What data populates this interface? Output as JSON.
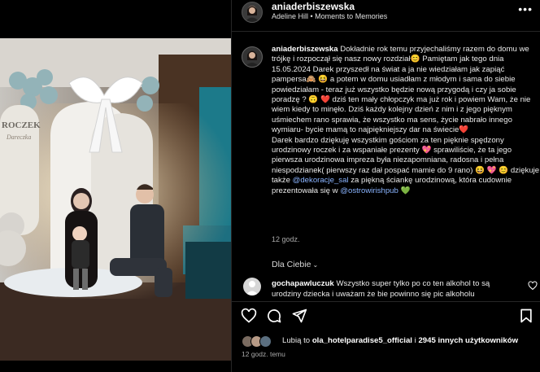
{
  "post": {
    "username": "aniaderbiszewska",
    "subtitle": "Adeline Hill • Moments to Memories",
    "caption_user": "aniaderbiszewska",
    "caption_text_1": "Dokładnie rok temu przyjechaliśmy razem do domu we trójkę i rozpoczął się nasz nowy rozdział😊 Pamiętam jak tego dnia 15.05.2024 Darek przyszedł na świat a ja nie wiedziałam jak zapiąć pampersa🙈 😆 a potem w domu usiadłam z młodym i sama do siebie powiedziałam - teraz już wszystko będzie nową przygodą i czy ja sobie poradzę ? 🙃 ❤️ dziś ten mały chłopczyk ma już rok i powiem Wam, że nie wiem kiedy to minęło. Dziś każdy kolejny dzień z nim i z jego pięknym uśmiechem rano sprawia, że wszystko ma sens, życie nabrało innego wymiaru- bycie mamą to najpiękniejszy dar na świecie❤️",
    "caption_text_2": "Darek bardzo dziękuję wszystkim gościom za ten pięknie spędzony urodzinowy roczek i za wspaniałe prezenty 💖 sprawiliście, że ta jego pierwsza urodzinowa impreza była niezapomniana, radosna i pełna niespodzianek( pierwszy raz dał pospać mamie do 9 rano) 😆 💖 😊 dziękuje także",
    "mention_1": "@dekoracje_sal",
    "caption_text_3": "za piękną ściankę urodzinową, która cudownie prezentowała się w",
    "mention_2": "@ostrowirishpub",
    "caption_text_4": "💚",
    "time": "12 godz.",
    "for_you": "Dla Ciebie",
    "comment_user": "gochapawluczuk",
    "comment_text": "Wszystko super tylko po co ten alkohol to są urodziny dziecka i uważam że bie powinno się pic alkoholu",
    "likes_prefix": "Lubią to",
    "likes_user": "ola_hotelparadise5_official",
    "likes_mid": "i",
    "likes_count": "2945 innych użytkowników",
    "ago": "12 godz. temu",
    "more": "•••"
  },
  "icons": {
    "like": "heart-icon",
    "comment": "comment-icon",
    "share": "share-icon",
    "save": "bookmark-icon"
  }
}
